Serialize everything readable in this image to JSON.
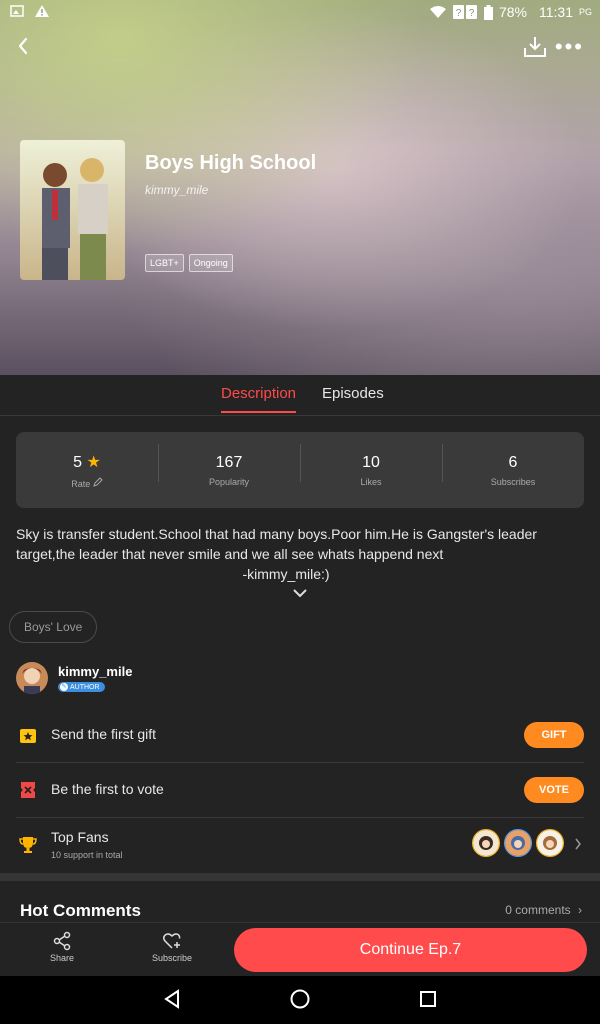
{
  "status": {
    "battery": "78%",
    "time": "11:31",
    "suffix": "PG"
  },
  "comic": {
    "title": "Boys High School",
    "author": "kimmy_mile",
    "tags": [
      "LGBT+",
      "Ongoing"
    ]
  },
  "tabs": [
    {
      "label": "Description"
    },
    {
      "label": "Episodes"
    }
  ],
  "stats": [
    {
      "value": "5",
      "label": "Rate"
    },
    {
      "value": "167",
      "label": "Popularity"
    },
    {
      "value": "10",
      "label": "Likes"
    },
    {
      "value": "6",
      "label": "Subscribes"
    }
  ],
  "description": {
    "line1": "Sky is transfer student.School that had many boys.Poor him.He is Gangster's  leader",
    "line2": "target,the leader that never smile and we all see whats happend next",
    "sign": "-kimmy_mile:)"
  },
  "genre": "Boys' Love",
  "creator": {
    "name": "kimmy_mile",
    "badge": "AUTHOR"
  },
  "gift": {
    "text": "Send the first gift",
    "button": "GIFT"
  },
  "vote": {
    "text": "Be the first to vote",
    "button": "VOTE"
  },
  "fans": {
    "title": "Top Fans",
    "sub": "10 support in total"
  },
  "comments": {
    "title": "Hot Comments",
    "count": "0 comments"
  },
  "bottom": {
    "share": "Share",
    "subscribe": "Subscribe",
    "continue": "Continue Ep.7"
  },
  "colors": {
    "accent": "#ff4b4b",
    "orange": "#ff8a1f",
    "background": "#232323"
  }
}
